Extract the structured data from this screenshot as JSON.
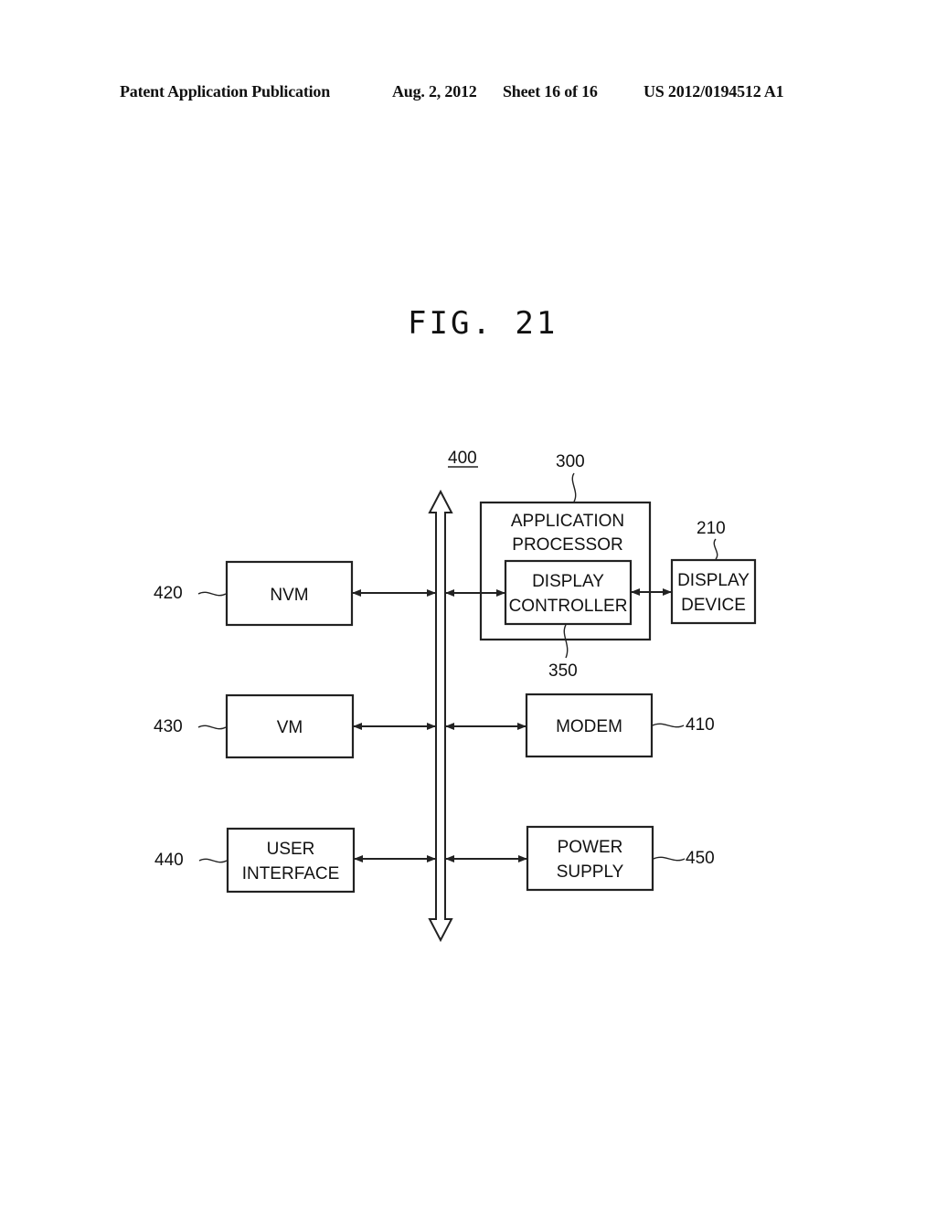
{
  "header": {
    "publication": "Patent Application Publication",
    "date": "Aug. 2, 2012",
    "sheet": "Sheet 16 of 16",
    "number": "US 2012/0194512 A1"
  },
  "figure": {
    "title": "FIG. 21",
    "system_ref": "400",
    "bus": {
      "type": "bidirectional-arrow"
    },
    "blocks": {
      "nvm": {
        "ref": "420",
        "lines": [
          "NVM"
        ]
      },
      "vm": {
        "ref": "430",
        "lines": [
          "VM"
        ]
      },
      "user_interface": {
        "ref": "440",
        "lines": [
          "USER",
          "INTERFACE"
        ]
      },
      "application_processor": {
        "ref": "300",
        "lines": [
          "APPLICATION",
          "PROCESSOR"
        ]
      },
      "display_controller": {
        "ref": "350",
        "lines": [
          "DISPLAY",
          "CONTROLLER"
        ]
      },
      "display_device": {
        "ref": "210",
        "lines": [
          "DISPLAY",
          "DEVICE"
        ]
      },
      "modem": {
        "ref": "410",
        "lines": [
          "MODEM"
        ]
      },
      "power_supply": {
        "ref": "450",
        "lines": [
          "POWER",
          "SUPPLY"
        ]
      }
    },
    "connections": [
      [
        "nvm",
        "bus"
      ],
      [
        "bus",
        "display_controller"
      ],
      [
        "display_controller",
        "display_device"
      ],
      [
        "vm",
        "bus"
      ],
      [
        "bus",
        "modem"
      ],
      [
        "user_interface",
        "bus"
      ],
      [
        "bus",
        "power_supply"
      ]
    ]
  }
}
